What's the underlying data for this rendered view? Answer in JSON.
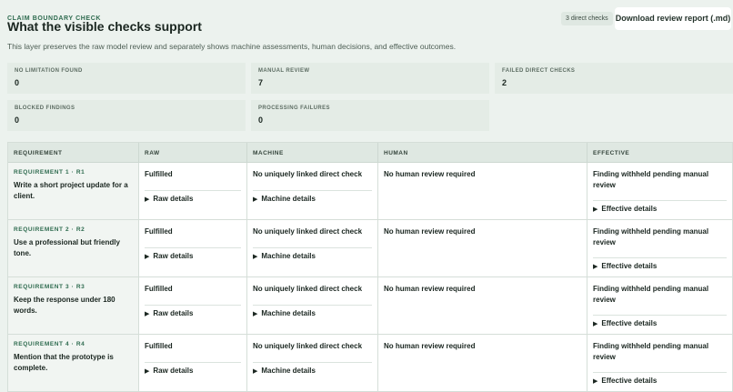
{
  "header": {
    "eyebrow": "CLAIM BOUNDARY CHECK",
    "title": "What the visible checks support",
    "subtitle": "This layer preserves the raw model review and separately shows machine assessments, human decisions, and effective outcomes.",
    "badge": "3 direct checks",
    "download_label": "Download review report (.md)"
  },
  "stats": [
    {
      "label": "NO LIMITATION FOUND",
      "value": "0"
    },
    {
      "label": "MANUAL REVIEW",
      "value": "7"
    },
    {
      "label": "FAILED DIRECT CHECKS",
      "value": "2"
    },
    {
      "label": "BLOCKED FINDINGS",
      "value": "0"
    },
    {
      "label": "PROCESSING FAILURES",
      "value": "0"
    }
  ],
  "table": {
    "columns": [
      "REQUIREMENT",
      "RAW",
      "MACHINE",
      "HUMAN",
      "EFFECTIVE"
    ],
    "raw_details_label": "Raw details",
    "machine_details_label": "Machine details",
    "effective_details_label": "Effective details",
    "rows": [
      {
        "id": "REQUIREMENT 1 · R1",
        "text": "Write a short project update for a client.",
        "raw": "Fulfilled",
        "machine": "No uniquely linked direct check",
        "human": "No human review required",
        "effective": "Finding withheld pending manual review"
      },
      {
        "id": "REQUIREMENT 2 · R2",
        "text": "Use a professional but friendly tone.",
        "raw": "Fulfilled",
        "machine": "No uniquely linked direct check",
        "human": "No human review required",
        "effective": "Finding withheld pending manual review"
      },
      {
        "id": "REQUIREMENT 3 · R3",
        "text": "Keep the response under 180 words.",
        "raw": "Fulfilled",
        "machine": "No uniquely linked direct check",
        "human": "No human review required",
        "effective": "Finding withheld pending manual review"
      },
      {
        "id": "REQUIREMENT 4 · R4",
        "text": "Mention that the prototype is complete.",
        "raw": "Fulfilled",
        "machine": "No uniquely linked direct check",
        "human": "No human review required",
        "effective": "Finding withheld pending manual review"
      }
    ]
  }
}
